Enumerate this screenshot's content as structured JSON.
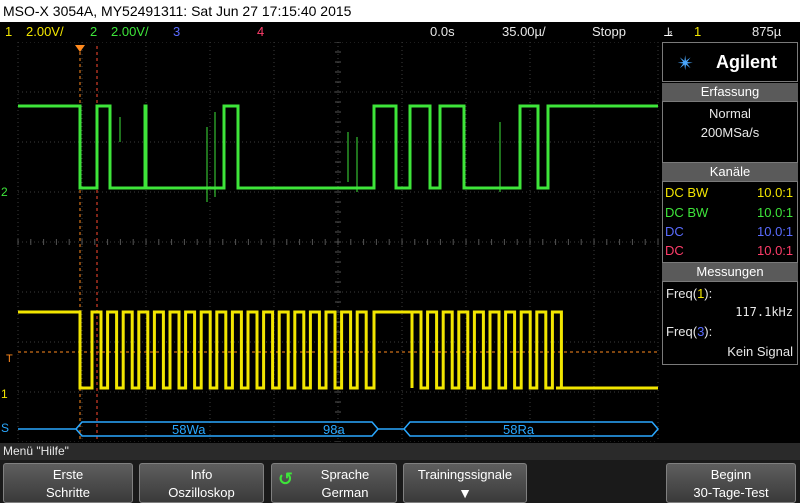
{
  "title": "MSO-X 3054A, MY52491311: Sat Jun 27 17:15:40 2015",
  "status": {
    "ch1_num": "1",
    "ch1_scale": "2.00V/",
    "ch2_num": "2",
    "ch2_scale": "2.00V/",
    "ch3_num": "3",
    "ch4_num": "4",
    "time_delay": "0.0s",
    "time_scale": "35.00µ/",
    "run_state": "Stopp",
    "trig_icon": "trigger-edge-icon",
    "trig_ch": "1",
    "trig_level": "875µ"
  },
  "markers": {
    "ch2": "2",
    "trig": "T",
    "ch1": "1",
    "serial": "S"
  },
  "serial_decode": [
    "58Wa",
    "98a",
    "58Ra"
  ],
  "sidebar": {
    "logo": "Agilent",
    "acquisition": {
      "header": "Erfassung",
      "mode": "Normal",
      "rate": "200MSa/s"
    },
    "channels": {
      "header": "Kanäle",
      "rows": [
        {
          "coupling": "DC BW",
          "probe": "10.0:1",
          "color": "#f2e600"
        },
        {
          "coupling": "DC BW",
          "probe": "10.0:1",
          "color": "#3ee53a"
        },
        {
          "coupling": "DC",
          "probe": "10.0:1",
          "color": "#5a6cff"
        },
        {
          "coupling": "DC",
          "probe": "10.0:1",
          "color": "#ff3d6a"
        }
      ]
    },
    "measurements": {
      "header": "Messungen",
      "freq1_label": "Freq(",
      "freq1_ch": "1",
      "freq1_close": "):",
      "freq1_value": "117.1kHz",
      "freq3_label": "Freq(",
      "freq3_ch": "3",
      "freq3_close": "):",
      "freq3_value": "Kein Signal"
    }
  },
  "menu": {
    "label": "Menü \"Hilfe\""
  },
  "softkeys": [
    {
      "line1": "Erste",
      "line2": "Schritte"
    },
    {
      "line1": "Info",
      "line2": "Oszilloskop"
    },
    {
      "line1": "Sprache",
      "line2": "German"
    },
    {
      "line1": "Trainingssignale",
      "line2": ""
    },
    {
      "line1": "Beginn",
      "line2": "30-Tage-Test"
    }
  ],
  "colors": {
    "ch1": "#f2e600",
    "ch2": "#3ee53a",
    "ch3": "#5a6cff",
    "ch4": "#ff3d6a",
    "serial": "#2aa8ff",
    "trigger": "#ff8a1e"
  }
}
